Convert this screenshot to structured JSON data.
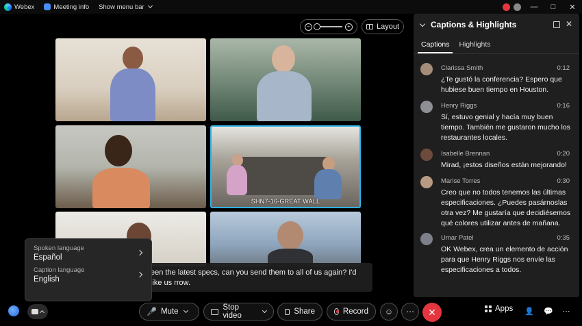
{
  "titlebar": {
    "app_name": "Webex",
    "meeting_info": "Meeting info",
    "show_menu_bar": "Show menu bar"
  },
  "stage": {
    "layout_label": "Layout",
    "tiles": [
      {
        "label": ""
      },
      {
        "label": ""
      },
      {
        "label": ""
      },
      {
        "label": "SHN7-16-GREAT WALL"
      },
      {
        "label": ""
      },
      {
        "label": ""
      }
    ],
    "active_speaker_border": "#2fb3e6"
  },
  "live_caption": {
    "text": "een the latest specs, can you send them to all of us again? I'd like us rrow."
  },
  "language_menu": {
    "spoken_label": "Spoken language",
    "spoken_value": "Español",
    "caption_label": "Caption language",
    "caption_value": "English"
  },
  "controls": {
    "mute": "Mute",
    "stop_video": "Stop video",
    "share": "Share",
    "record": "Record",
    "apps": "Apps",
    "end_color": "#e5363f"
  },
  "panel": {
    "title": "Captions & Highlights",
    "tabs": [
      "Captions",
      "Highlights"
    ],
    "entries": [
      {
        "name": "Clarissa Smith",
        "time": "0:12",
        "text": "¿Te gustó la conferencia? Espero que hubiese buen tiempo en Houston.",
        "avatar_color": "#a58d7a"
      },
      {
        "name": "Henry Riggs",
        "time": "0:16",
        "text": "Sí, estuvo genial y hacía muy buen tiempo. También me gustaron mucho los restaurantes locales.",
        "avatar_color": "#8d8f94"
      },
      {
        "name": "Isabelle Brennan",
        "time": "0:20",
        "text": "Mirad, ¡estos diseños están mejorando!",
        "avatar_color": "#6d4b3c"
      },
      {
        "name": "Marise Torres",
        "time": "0:30",
        "text": "Creo que no todos tenemos las últimas especificaciones. ¿Puedes pasárnoslas otra vez? Me gustaría que decidiésemos qué colores utilizar antes de mañana.",
        "avatar_color": "#b99a82"
      },
      {
        "name": "Umar Patel",
        "time": "0:35",
        "text": "OK Webex, crea un elemento de acción para que Henry Riggs nos envíe las especificaciones a todos.",
        "avatar_color": "#7d7f8a"
      }
    ]
  }
}
